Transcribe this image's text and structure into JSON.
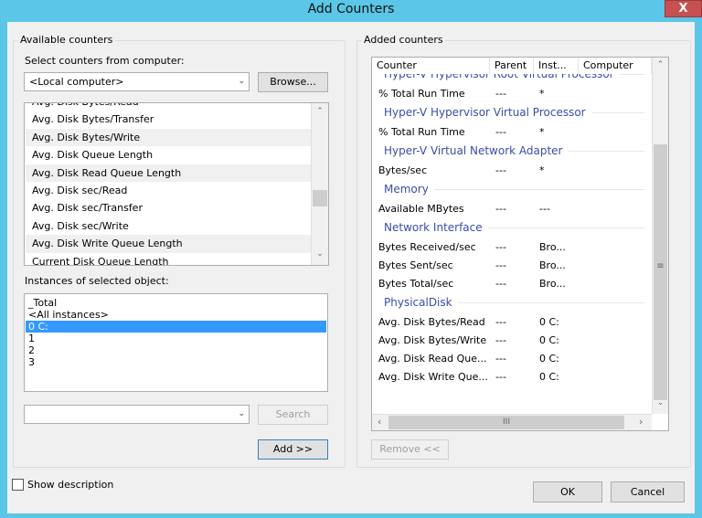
{
  "window": {
    "title": "Add Counters",
    "close_label": "X"
  },
  "available": {
    "group_label": "Available counters",
    "computer_label": "Select counters from computer:",
    "computer_value": "<Local computer>",
    "browse_label": "Browse...",
    "counters": [
      "Avg. Disk Bytes/Read",
      "Avg. Disk Bytes/Transfer",
      "Avg. Disk Bytes/Write",
      "Avg. Disk Queue Length",
      "Avg. Disk Read Queue Length",
      "Avg. Disk sec/Read",
      "Avg. Disk sec/Transfer",
      "Avg. Disk sec/Write",
      "Avg. Disk Write Queue Length",
      "Current Disk Queue Length"
    ],
    "instances_label": "Instances of selected object:",
    "instances": [
      "_Total",
      "<All instances>",
      "0 C:",
      "1",
      "2",
      "3"
    ],
    "selected_instance": "0 C:",
    "search_value": "",
    "search_label": "Search",
    "add_label": "Add >>"
  },
  "added": {
    "group_label": "Added counters",
    "columns": [
      "Counter",
      "Parent",
      "Inst...",
      "Computer"
    ],
    "rows": [
      {
        "type": "group",
        "name": "Hyper-V Hypervisor Root Virtual Processor"
      },
      {
        "type": "item",
        "counter": "% Total Run Time",
        "parent": "---",
        "instance": "*"
      },
      {
        "type": "group",
        "name": "Hyper-V Hypervisor Virtual Processor"
      },
      {
        "type": "item",
        "counter": "% Total Run Time",
        "parent": "---",
        "instance": "*"
      },
      {
        "type": "group",
        "name": "Hyper-V Virtual Network Adapter"
      },
      {
        "type": "item",
        "counter": "Bytes/sec",
        "parent": "---",
        "instance": "*"
      },
      {
        "type": "group",
        "name": "Memory"
      },
      {
        "type": "item",
        "counter": "Available MBytes",
        "parent": "---",
        "instance": "---"
      },
      {
        "type": "group",
        "name": "Network Interface"
      },
      {
        "type": "item",
        "counter": "Bytes Received/sec",
        "parent": "---",
        "instance": "Bro..."
      },
      {
        "type": "item",
        "counter": "Bytes Sent/sec",
        "parent": "---",
        "instance": "Bro..."
      },
      {
        "type": "item",
        "counter": "Bytes Total/sec",
        "parent": "---",
        "instance": "Bro..."
      },
      {
        "type": "group",
        "name": "PhysicalDisk"
      },
      {
        "type": "item",
        "counter": "Avg. Disk Bytes/Read",
        "parent": "---",
        "instance": "0 C:"
      },
      {
        "type": "item",
        "counter": "Avg. Disk Bytes/Write",
        "parent": "---",
        "instance": "0 C:"
      },
      {
        "type": "item",
        "counter": "Avg. Disk Read Que...",
        "parent": "---",
        "instance": "0 C:"
      },
      {
        "type": "item",
        "counter": "Avg. Disk Write Que...",
        "parent": "---",
        "instance": "0 C:"
      }
    ],
    "remove_label": "Remove <<"
  },
  "footer": {
    "show_description_label": "Show description",
    "show_description_checked": false,
    "ok_label": "OK",
    "cancel_label": "Cancel"
  },
  "colors": {
    "titlebar": "#5bc6e8",
    "close": "#c75050",
    "selection": "#3399ff",
    "group_header": "#3c4ca8"
  }
}
